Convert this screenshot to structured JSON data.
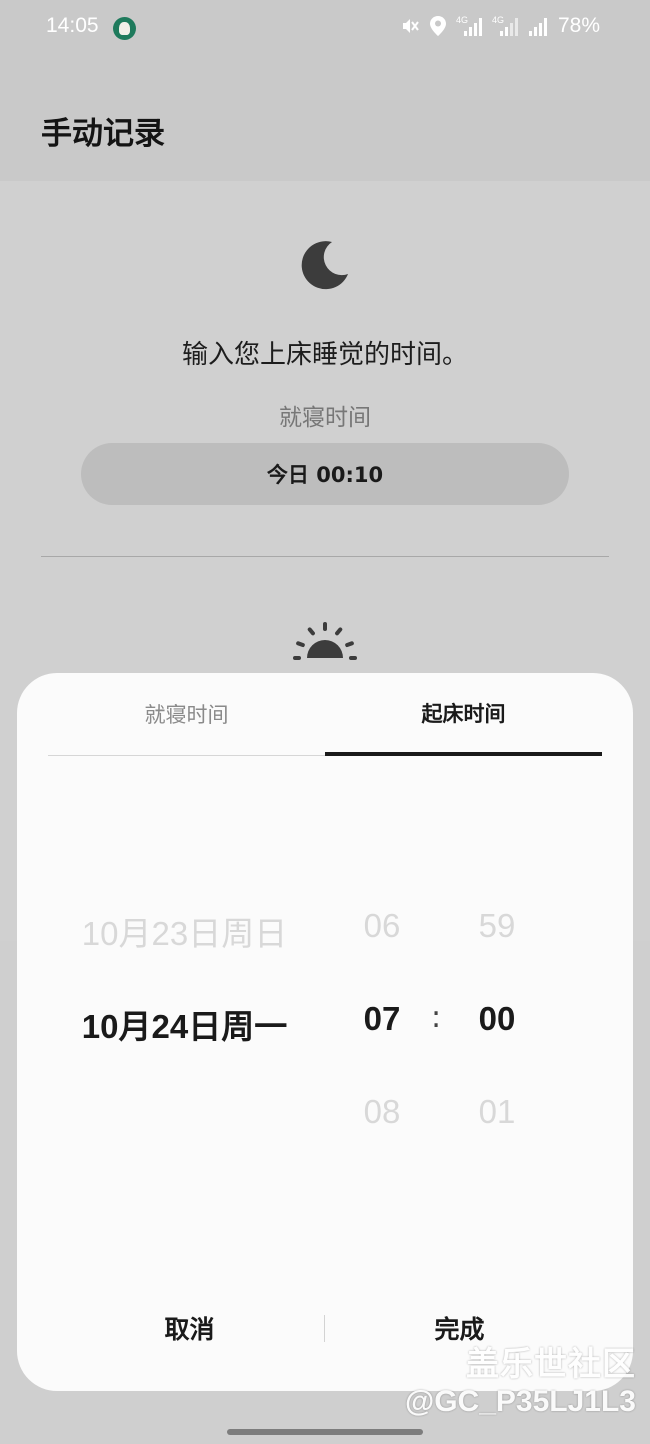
{
  "status_bar": {
    "time": "14:05",
    "battery": "78%",
    "icons": [
      "avatar-icon",
      "mute-icon",
      "location-icon",
      "signal-4g-icon",
      "signal-4g-icon",
      "signal-icon"
    ]
  },
  "header": {
    "title": "手动记录"
  },
  "content": {
    "moon_icon": "moon-icon",
    "prompt": "输入您上床睡觉的时间。",
    "bedtime_label": "就寝时间",
    "bedtime_value": "今日 00:10",
    "sun_icon": "sunrise-icon"
  },
  "sheet": {
    "tabs": [
      {
        "label": "就寝时间",
        "active": false
      },
      {
        "label": "起床时间",
        "active": true
      }
    ],
    "picker": {
      "date": {
        "prev": "10月23日周日",
        "selected": "10月24日周一",
        "next": ""
      },
      "hour": {
        "prev": "06",
        "selected": "07",
        "next": "08"
      },
      "minute": {
        "prev": "59",
        "selected": "00",
        "next": "01"
      },
      "separator": ":"
    },
    "actions": {
      "cancel": "取消",
      "done": "完成"
    }
  },
  "watermark": {
    "line1": "盖乐世社区",
    "line2": "@GC_P35LJ1L3"
  }
}
